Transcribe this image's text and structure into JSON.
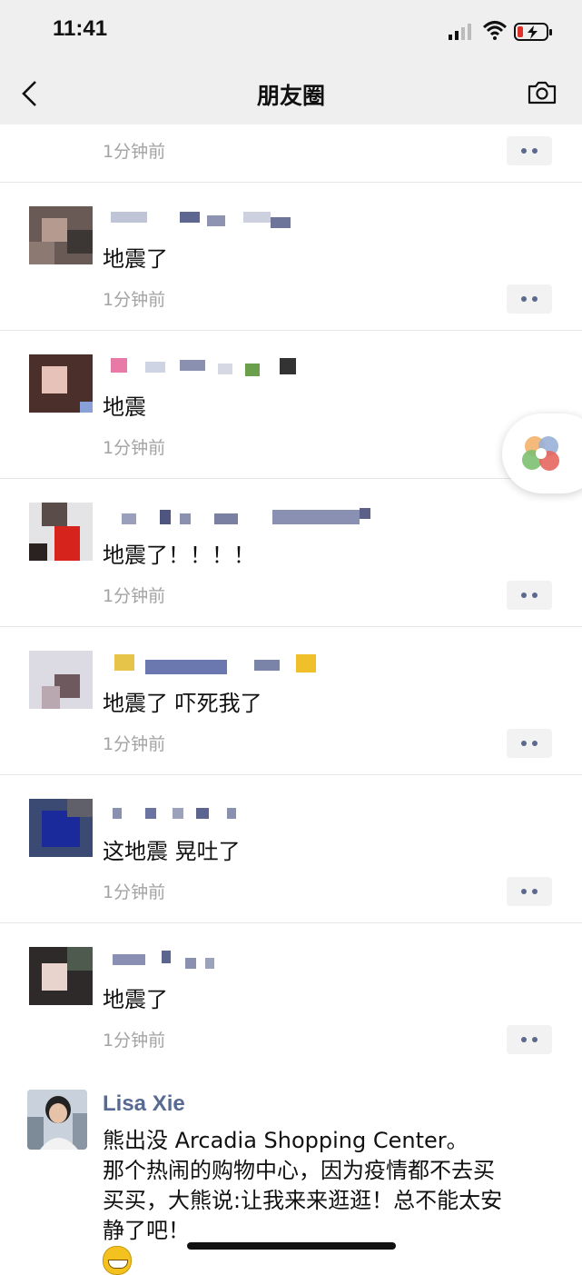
{
  "status_bar": {
    "time": "11:41"
  },
  "nav": {
    "title": "朋友圈"
  },
  "feed": {
    "first_time": "1分钟前",
    "posts": [
      {
        "text": "地震了",
        "time": "1分钟前"
      },
      {
        "text": "地震",
        "time": "1分钟前"
      },
      {
        "text": "地震了！！！！",
        "time": "1分钟前"
      },
      {
        "text": "地震了 吓死我了",
        "time": "1分钟前"
      },
      {
        "text": "这地震 晃吐了",
        "time": "1分钟前"
      },
      {
        "text": "地震了",
        "time": "1分钟前"
      }
    ]
  },
  "last_post": {
    "name": "Lisa Xie",
    "line1": "熊出没 Arcadia Shopping Center。",
    "line2": "那个热闹的购物中心，因为疫情都不去买",
    "line3": "买买，大熊说:让我来来逛逛！总不能太安",
    "line4": "静了吧！"
  },
  "icons": {
    "back": "chevron-left-icon",
    "camera": "camera-icon",
    "more": "more-dots-icon",
    "float": "mini-program-float-icon"
  },
  "colors": {
    "link_name": "#586a94",
    "timestamp": "#a3a3a3",
    "more_dots": "#5b6a8c"
  }
}
